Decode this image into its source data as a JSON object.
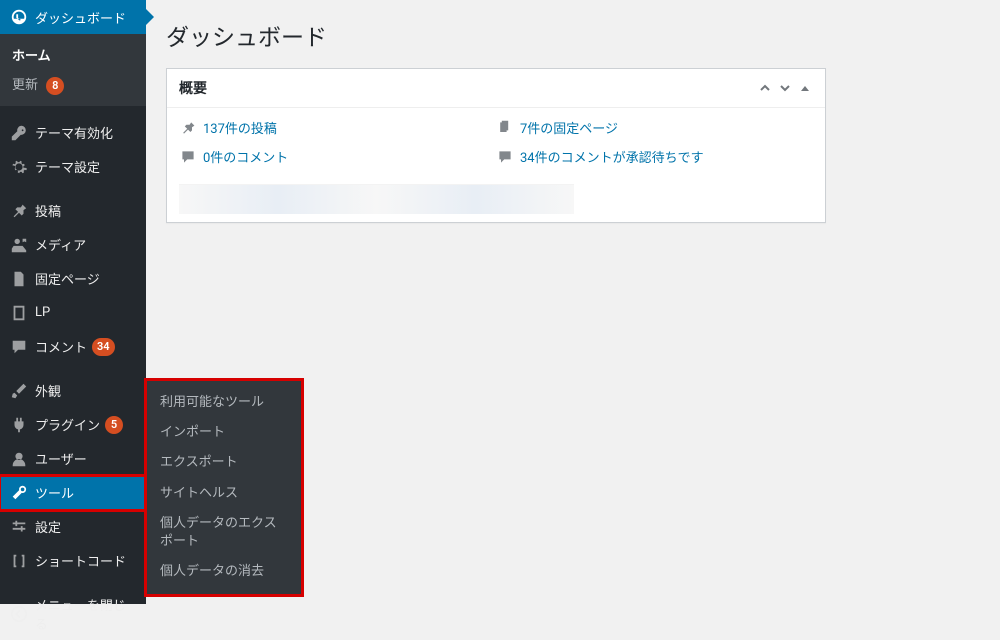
{
  "page": {
    "title": "ダッシュボード"
  },
  "sidebar": {
    "dashboard": "ダッシュボード",
    "home": "ホーム",
    "updates": "更新",
    "updates_badge": "8",
    "theme_activate": "テーマ有効化",
    "theme_settings": "テーマ設定",
    "posts": "投稿",
    "media": "メディア",
    "pages": "固定ページ",
    "lp": "LP",
    "comments": "コメント",
    "comments_badge": "34",
    "appearance": "外観",
    "plugins": "プラグイン",
    "plugins_badge": "5",
    "users": "ユーザー",
    "tools": "ツール",
    "settings": "設定",
    "shortcode": "ショートコード",
    "collapse": "メニューを閉じる"
  },
  "flyout": {
    "available": "利用可能なツール",
    "import": "インポート",
    "export": "エクスポート",
    "sitehealth": "サイトヘルス",
    "export_personal": "個人データのエクスポート",
    "erase_personal": "個人データの消去"
  },
  "panel": {
    "title": "概要",
    "posts": "137件の投稿",
    "pages": "7件の固定ページ",
    "comments": "0件のコメント",
    "pending": "34件のコメントが承認待ちです"
  }
}
